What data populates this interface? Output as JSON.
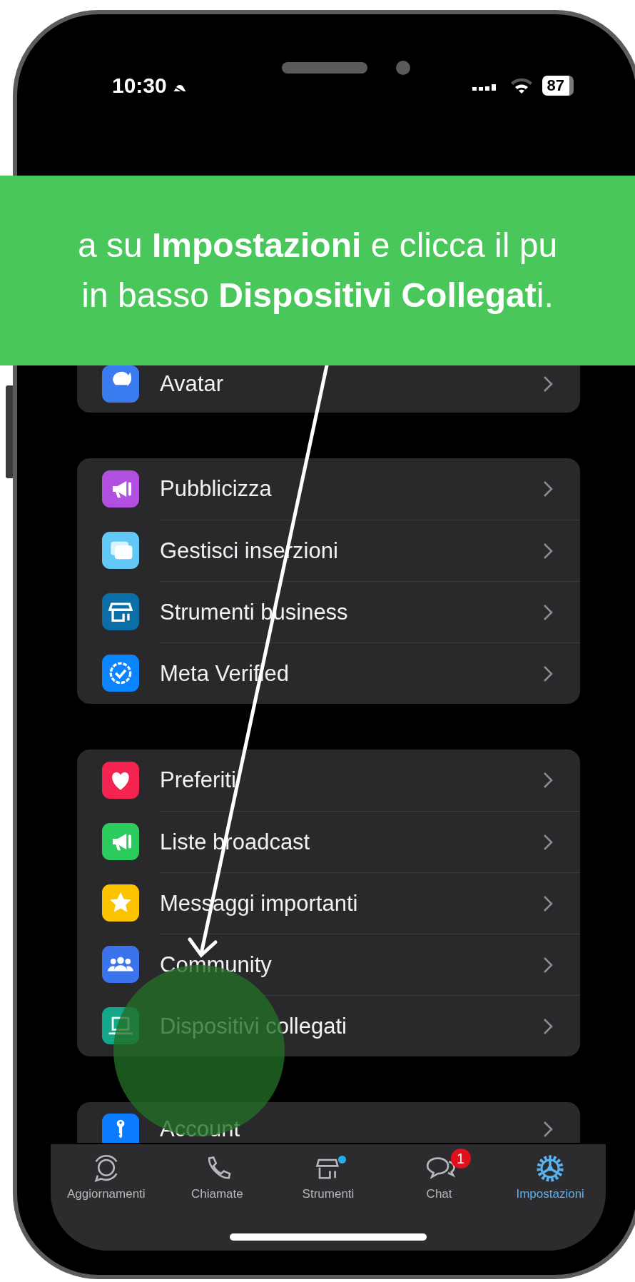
{
  "status_bar": {
    "time": "10:30",
    "battery": "87"
  },
  "banner": {
    "text": "a su **Impostazioni** e clicca il pu\nin basso **Dispositivi Collegat**i."
  },
  "groups": [
    {
      "rows": [
        {
          "label": "Avatar",
          "color": "#3a7bf0"
        }
      ]
    },
    {
      "rows": [
        {
          "label": "Pubblicizza",
          "color": "#b14fe0"
        },
        {
          "label": "Gestisci inserzioni",
          "color": "#62c8f5"
        },
        {
          "label": "Strumenti business",
          "color": "#0b6ea6"
        },
        {
          "label": "Meta Verified",
          "color": "#0a84ff"
        }
      ]
    },
    {
      "rows": [
        {
          "label": "Preferiti",
          "color": "#f5234f"
        },
        {
          "label": "Liste broadcast",
          "color": "#2bcb5e"
        },
        {
          "label": "Messaggi importanti",
          "color": "#fcc400"
        },
        {
          "label": "Community",
          "color": "#3a73ec"
        },
        {
          "label": "Dispositivi collegati",
          "color": "#14a88a"
        }
      ]
    },
    {
      "rows": [
        {
          "label": "Account",
          "color": "#0a7cff"
        }
      ]
    }
  ],
  "tab_bar": {
    "tabs": [
      {
        "label": "Aggiornamenti",
        "selected": false,
        "dot": false
      },
      {
        "label": "Chiamate",
        "selected": false,
        "dot": false
      },
      {
        "label": "Strumenti",
        "selected": false,
        "dot": true
      },
      {
        "label": "Chat",
        "selected": false,
        "dot": false,
        "badge": "1"
      },
      {
        "label": "Impostazioni",
        "selected": true,
        "dot": false
      }
    ]
  }
}
